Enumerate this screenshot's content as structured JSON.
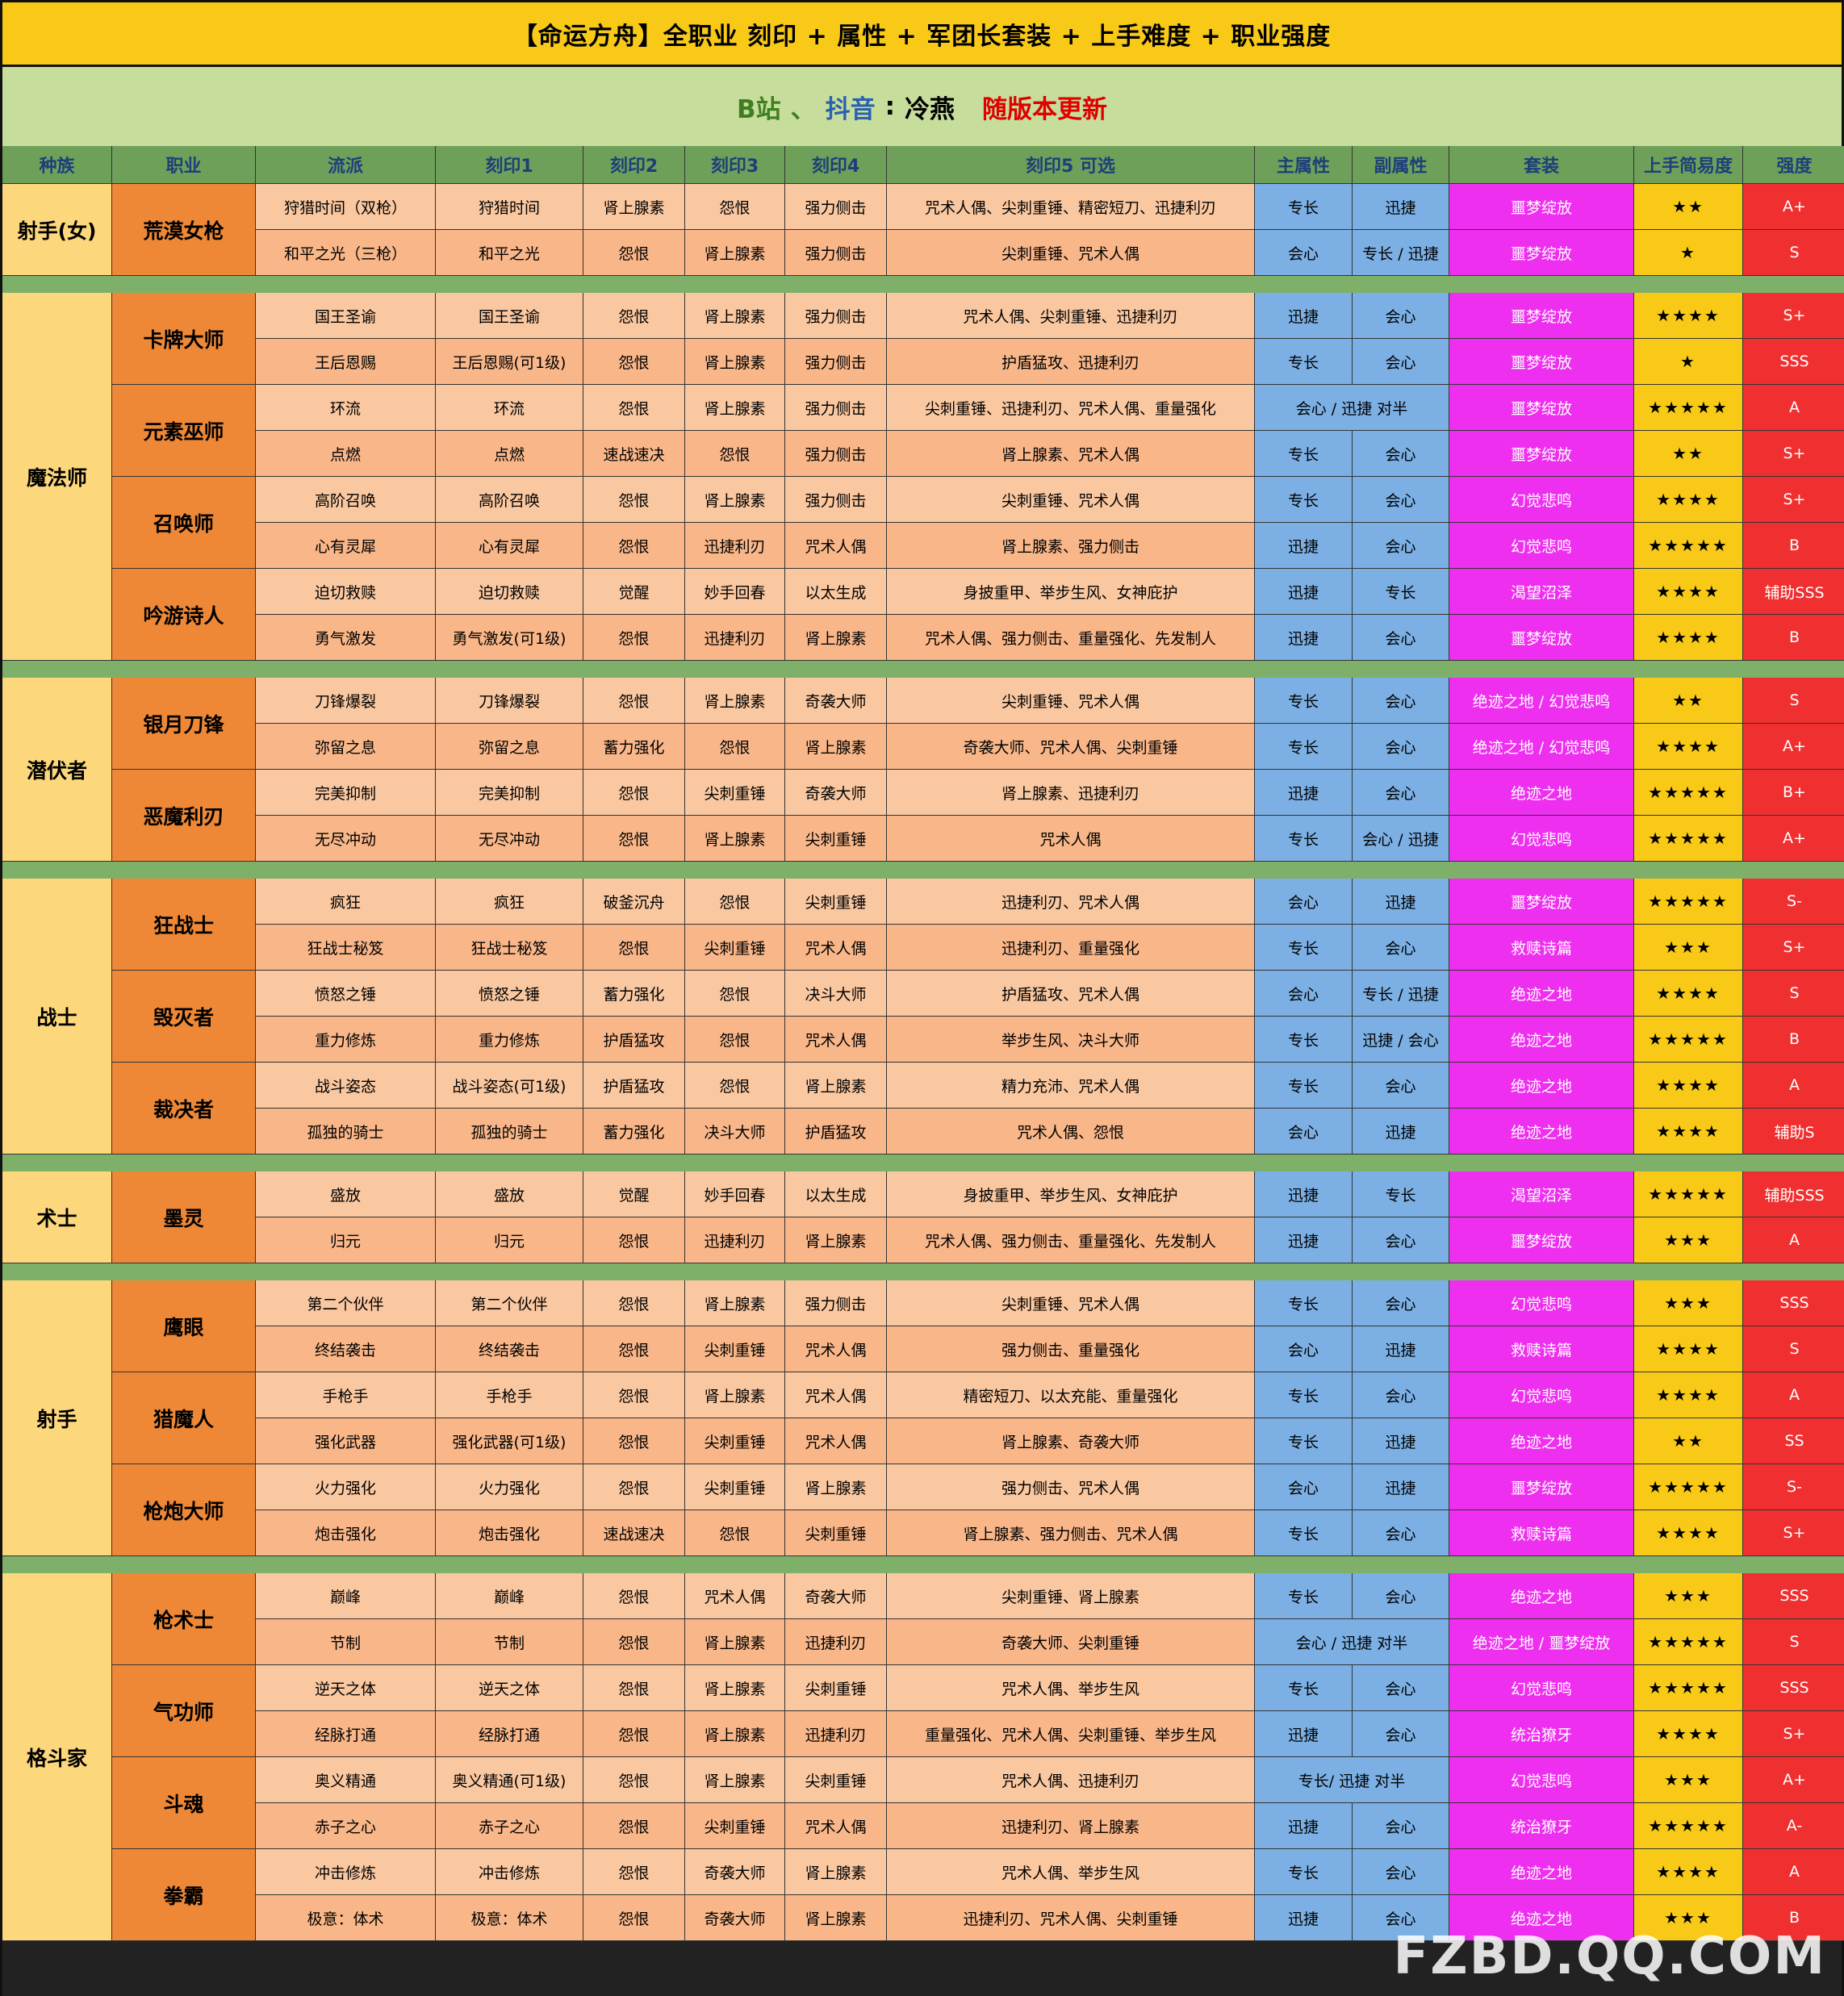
{
  "title": "【命运方舟】全职业 刻印 + 属性 + 军团长套装 + 上手难度 + 职业强度",
  "subtitle": {
    "b": "B站",
    "sep": "、",
    "douyin": "抖音",
    "colon": ":",
    "author": "冷燕",
    "update": "随版本更新"
  },
  "headers": [
    "种族",
    "职业",
    "流派",
    "刻印1",
    "刻印2",
    "刻印3",
    "刻印4",
    "刻印5 可选",
    "主属性",
    "副属性",
    "套装",
    "上手简易度",
    "强度"
  ],
  "races": [
    "射手(女)",
    "魔法师",
    "潜伏者",
    "战士",
    "术士",
    "射手",
    "格斗家"
  ],
  "classes": [
    "荒漠女枪",
    "卡牌大师",
    "元素巫师",
    "召唤师",
    "吟游诗人",
    "银月刀锋",
    "恶魔利刃",
    "狂战士",
    "毁灭者",
    "裁决者",
    "墨灵",
    "鹰眼",
    "猎魔人",
    "枪炮大师",
    "枪术士",
    "气功师",
    "斗魂",
    "拳霸"
  ],
  "rows": [
    [
      "狩猎时间（双枪）",
      "狩猎时间",
      "肾上腺素",
      "怨恨",
      "强力侧击",
      "咒术人偶、尖刺重锤、精密短刀、迅捷利刃",
      "专长",
      "迅捷",
      "噩梦绽放",
      "★★",
      "A+"
    ],
    [
      "和平之光（三枪）",
      "和平之光",
      "怨恨",
      "肾上腺素",
      "强力侧击",
      "尖刺重锤、咒术人偶",
      "会心",
      "专长 / 迅捷",
      "噩梦绽放",
      "★",
      "S"
    ],
    [
      "国王圣谕",
      "国王圣谕",
      "怨恨",
      "肾上腺素",
      "强力侧击",
      "咒术人偶、尖刺重锤、迅捷利刃",
      "迅捷",
      "会心",
      "噩梦绽放",
      "★★★★",
      "S+"
    ],
    [
      "王后恩赐",
      "王后恩赐(可1级)",
      "怨恨",
      "肾上腺素",
      "强力侧击",
      "护盾猛攻、迅捷利刃",
      "专长",
      "会心",
      "噩梦绽放",
      "★",
      "SSS"
    ],
    [
      "环流",
      "环流",
      "怨恨",
      "肾上腺素",
      "强力侧击",
      "尖刺重锤、迅捷利刃、咒术人偶、重量强化",
      "会心 / 迅捷 对半",
      "",
      "噩梦绽放",
      "★★★★★",
      "A"
    ],
    [
      "点燃",
      "点燃",
      "速战速决",
      "怨恨",
      "强力侧击",
      "肾上腺素、咒术人偶",
      "专长",
      "会心",
      "噩梦绽放",
      "★★",
      "S+"
    ],
    [
      "高阶召唤",
      "高阶召唤",
      "怨恨",
      "肾上腺素",
      "强力侧击",
      "尖刺重锤、咒术人偶",
      "专长",
      "会心",
      "幻觉悲鸣",
      "★★★★",
      "S+"
    ],
    [
      "心有灵犀",
      "心有灵犀",
      "怨恨",
      "迅捷利刃",
      "咒术人偶",
      "肾上腺素、强力侧击",
      "迅捷",
      "会心",
      "幻觉悲鸣",
      "★★★★★",
      "B"
    ],
    [
      "迫切救赎",
      "迫切救赎",
      "觉醒",
      "妙手回春",
      "以太生成",
      "身披重甲、举步生风、女神庇护",
      "迅捷",
      "专长",
      "渴望沼泽",
      "★★★★",
      "辅助SSS"
    ],
    [
      "勇气激发",
      "勇气激发(可1级)",
      "怨恨",
      "迅捷利刃",
      "肾上腺素",
      "咒术人偶、强力侧击、重量强化、先发制人",
      "迅捷",
      "会心",
      "噩梦绽放",
      "★★★★",
      "B"
    ],
    [
      "刀锋爆裂",
      "刀锋爆裂",
      "怨恨",
      "肾上腺素",
      "奇袭大师",
      "尖刺重锤、咒术人偶",
      "专长",
      "会心",
      "绝迹之地 / 幻觉悲鸣",
      "★★",
      "S"
    ],
    [
      "弥留之息",
      "弥留之息",
      "蓄力强化",
      "怨恨",
      "肾上腺素",
      "奇袭大师、咒术人偶、尖刺重锤",
      "专长",
      "会心",
      "绝迹之地 / 幻觉悲鸣",
      "★★★★",
      "A+"
    ],
    [
      "完美抑制",
      "完美抑制",
      "怨恨",
      "尖刺重锤",
      "奇袭大师",
      "肾上腺素、迅捷利刃",
      "迅捷",
      "会心",
      "绝迹之地",
      "★★★★★",
      "B+"
    ],
    [
      "无尽冲动",
      "无尽冲动",
      "怨恨",
      "肾上腺素",
      "尖刺重锤",
      "咒术人偶",
      "专长",
      "会心 / 迅捷",
      "幻觉悲鸣",
      "★★★★★",
      "A+"
    ],
    [
      "疯狂",
      "疯狂",
      "破釜沉舟",
      "怨恨",
      "尖刺重锤",
      "迅捷利刃、咒术人偶",
      "会心",
      "迅捷",
      "噩梦绽放",
      "★★★★★",
      "S-"
    ],
    [
      "狂战士秘笈",
      "狂战士秘笈",
      "怨恨",
      "尖刺重锤",
      "咒术人偶",
      "迅捷利刃、重量强化",
      "专长",
      "会心",
      "救赎诗篇",
      "★★★",
      "S+"
    ],
    [
      "愤怒之锤",
      "愤怒之锤",
      "蓄力强化",
      "怨恨",
      "决斗大师",
      "护盾猛攻、咒术人偶",
      "会心",
      "专长 / 迅捷",
      "绝迹之地",
      "★★★★",
      "S"
    ],
    [
      "重力修炼",
      "重力修炼",
      "护盾猛攻",
      "怨恨",
      "咒术人偶",
      "举步生风、决斗大师",
      "专长",
      "迅捷 / 会心",
      "绝迹之地",
      "★★★★★",
      "B"
    ],
    [
      "战斗姿态",
      "战斗姿态(可1级)",
      "护盾猛攻",
      "怨恨",
      "肾上腺素",
      "精力充沛、咒术人偶",
      "专长",
      "会心",
      "绝迹之地",
      "★★★★",
      "A"
    ],
    [
      "孤独的骑士",
      "孤独的骑士",
      "蓄力强化",
      "决斗大师",
      "护盾猛攻",
      "咒术人偶、怨恨",
      "会心",
      "迅捷",
      "绝迹之地",
      "★★★★",
      "辅助S"
    ],
    [
      "盛放",
      "盛放",
      "觉醒",
      "妙手回春",
      "以太生成",
      "身披重甲、举步生风、女神庇护",
      "迅捷",
      "专长",
      "渴望沼泽",
      "★★★★★",
      "辅助SSS"
    ],
    [
      "归元",
      "归元",
      "怨恨",
      "迅捷利刃",
      "肾上腺素",
      "咒术人偶、强力侧击、重量强化、先发制人",
      "迅捷",
      "会心",
      "噩梦绽放",
      "★★★",
      "A"
    ],
    [
      "第二个伙伴",
      "第二个伙伴",
      "怨恨",
      "肾上腺素",
      "强力侧击",
      "尖刺重锤、咒术人偶",
      "专长",
      "会心",
      "幻觉悲鸣",
      "★★★",
      "SSS"
    ],
    [
      "终结袭击",
      "终结袭击",
      "怨恨",
      "尖刺重锤",
      "咒术人偶",
      "强力侧击、重量强化",
      "会心",
      "迅捷",
      "救赎诗篇",
      "★★★★",
      "S"
    ],
    [
      "手枪手",
      "手枪手",
      "怨恨",
      "肾上腺素",
      "咒术人偶",
      "精密短刀、以太充能、重量强化",
      "专长",
      "会心",
      "幻觉悲鸣",
      "★★★★",
      "A"
    ],
    [
      "强化武器",
      "强化武器(可1级)",
      "怨恨",
      "尖刺重锤",
      "咒术人偶",
      "肾上腺素、奇袭大师",
      "专长",
      "迅捷",
      "绝迹之地",
      "★★",
      "SS"
    ],
    [
      "火力强化",
      "火力强化",
      "怨恨",
      "尖刺重锤",
      "肾上腺素",
      "强力侧击、咒术人偶",
      "会心",
      "迅捷",
      "噩梦绽放",
      "★★★★★",
      "S-"
    ],
    [
      "炮击强化",
      "炮击强化",
      "速战速决",
      "怨恨",
      "尖刺重锤",
      "肾上腺素、强力侧击、咒术人偶",
      "专长",
      "会心",
      "救赎诗篇",
      "★★★★",
      "S+"
    ],
    [
      "巅峰",
      "巅峰",
      "怨恨",
      "咒术人偶",
      "奇袭大师",
      "尖刺重锤、肾上腺素",
      "专长",
      "会心",
      "绝迹之地",
      "★★★",
      "SSS"
    ],
    [
      "节制",
      "节制",
      "怨恨",
      "肾上腺素",
      "迅捷利刃",
      "奇袭大师、尖刺重锤",
      "会心 / 迅捷 对半",
      "",
      "绝迹之地 / 噩梦绽放",
      "★★★★★",
      "S"
    ],
    [
      "逆天之体",
      "逆天之体",
      "怨恨",
      "肾上腺素",
      "尖刺重锤",
      "咒术人偶、举步生风",
      "专长",
      "会心",
      "幻觉悲鸣",
      "★★★★★",
      "SSS"
    ],
    [
      "经脉打通",
      "经脉打通",
      "怨恨",
      "肾上腺素",
      "迅捷利刃",
      "重量强化、咒术人偶、尖刺重锤、举步生风",
      "迅捷",
      "会心",
      "统治獠牙",
      "★★★★",
      "S+"
    ],
    [
      "奥义精通",
      "奥义精通(可1级)",
      "怨恨",
      "肾上腺素",
      "尖刺重锤",
      "咒术人偶、迅捷利刃",
      "专长/ 迅捷 对半",
      "",
      "幻觉悲鸣",
      "★★★",
      "A+"
    ],
    [
      "赤子之心",
      "赤子之心",
      "怨恨",
      "尖刺重锤",
      "咒术人偶",
      "迅捷利刃、肾上腺素",
      "迅捷",
      "会心",
      "统治獠牙",
      "★★★★★",
      "A-"
    ],
    [
      "冲击修炼",
      "冲击修炼",
      "怨恨",
      "奇袭大师",
      "肾上腺素",
      "咒术人偶、举步生风",
      "专长",
      "会心",
      "绝迹之地",
      "★★★★",
      "A"
    ],
    [
      "极意：体术",
      "极意：体术",
      "怨恨",
      "奇袭大师",
      "肾上腺素",
      "迅捷利刃、咒术人偶、尖刺重锤",
      "迅捷",
      "会心",
      "绝迹之地",
      "★★★",
      "B"
    ]
  ],
  "watermark": "FZBD.QQ.COM"
}
